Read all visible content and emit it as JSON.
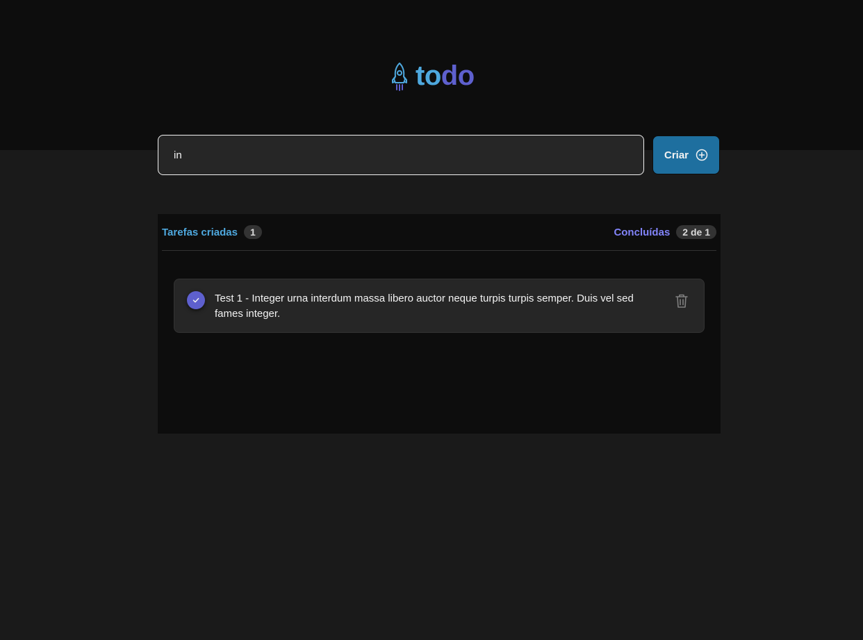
{
  "header": {
    "logo_icon": "rocket-icon",
    "logo_part1": "to",
    "logo_part2": "do",
    "colors": {
      "to": "#4ea8de",
      "do": "#5e60ce"
    }
  },
  "form": {
    "input_value": "in",
    "create_label": "Criar",
    "create_icon": "plus-circle-icon",
    "button_color": "#1e6f9f"
  },
  "stats": {
    "created_label": "Tarefas criadas",
    "created_count": "1",
    "done_label": "Concluídas",
    "done_count": "2 de 1"
  },
  "tasks": [
    {
      "text": "Test 1 - Integer urna interdum massa libero auctor neque turpis turpis semper. Duis vel sed fames integer.",
      "completed": true,
      "check_icon": "check-icon",
      "delete_icon": "trash-icon"
    }
  ]
}
